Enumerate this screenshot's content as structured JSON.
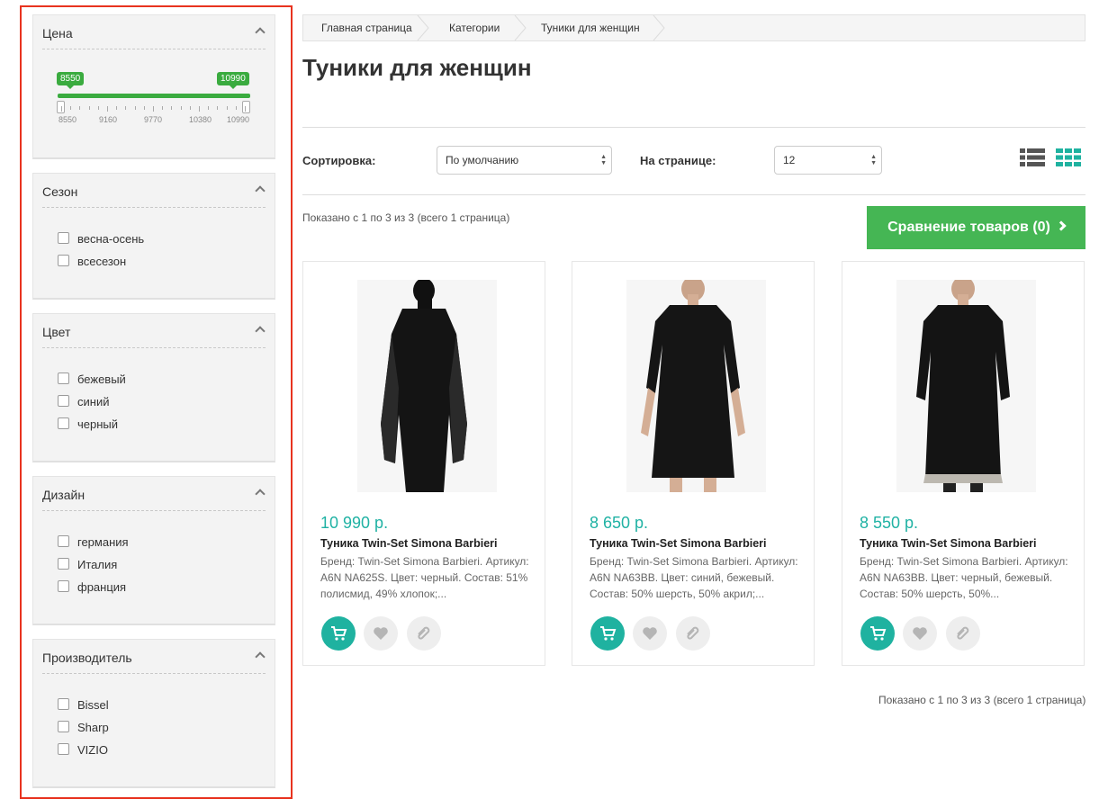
{
  "filters": {
    "price": {
      "title": "Цена",
      "min_label": "8550",
      "max_label": "10990",
      "scale": [
        "8550",
        "9160",
        "9770",
        "10380",
        "10990"
      ]
    },
    "season": {
      "title": "Сезон",
      "options": [
        "весна-осень",
        "всесезон"
      ]
    },
    "color": {
      "title": "Цвет",
      "options": [
        "бежевый",
        "синий",
        "черный"
      ]
    },
    "design": {
      "title": "Дизайн",
      "options": [
        "германия",
        "Италия",
        "франция"
      ]
    },
    "manufacturer": {
      "title": "Производитель",
      "options": [
        "Bissel",
        "Sharp",
        "VIZIO"
      ]
    }
  },
  "breadcrumb": [
    "Главная страница",
    "Категории",
    "Туники для женщин"
  ],
  "page_title": "Туники для женщин",
  "toolbar": {
    "sort_label": "Сортировка:",
    "sort_value": "По умолчанию",
    "per_page_label": "На странице:",
    "per_page_value": "12"
  },
  "showing_text": "Показано с 1 по 3 из 3 (всего 1 страница)",
  "compare_button": "Сравнение товаров (0)",
  "products": [
    {
      "price": "10 990 р.",
      "name": "Туника Twin-Set Simona Barbieri",
      "desc": "Бренд: Twin-Set Simona Barbieri. Артикул: A6N NA625S. Цвет: черный. Состав: 51% полисмид, 49% хлопок;..."
    },
    {
      "price": "8 650 р.",
      "name": "Туника Twin-Set Simona Barbieri",
      "desc": "Бренд: Twin-Set Simona Barbieri. Артикул: A6N NA63BB. Цвет: синий, бежевый. Состав: 50% шерсть, 50% акрил;..."
    },
    {
      "price": "8 550 р.",
      "name": "Туника Twin-Set Simona Barbieri",
      "desc": "Бренд: Twin-Set Simona Barbieri. Артикул: A6N NA63BB. Цвет: черный, бежевый. Состав: 50% шерсть, 50%..."
    }
  ],
  "colors": {
    "accent_teal": "#1fb2a0",
    "slider_green": "#3aab3f",
    "compare_green": "#45b654",
    "highlight_border": "#e8331f"
  }
}
